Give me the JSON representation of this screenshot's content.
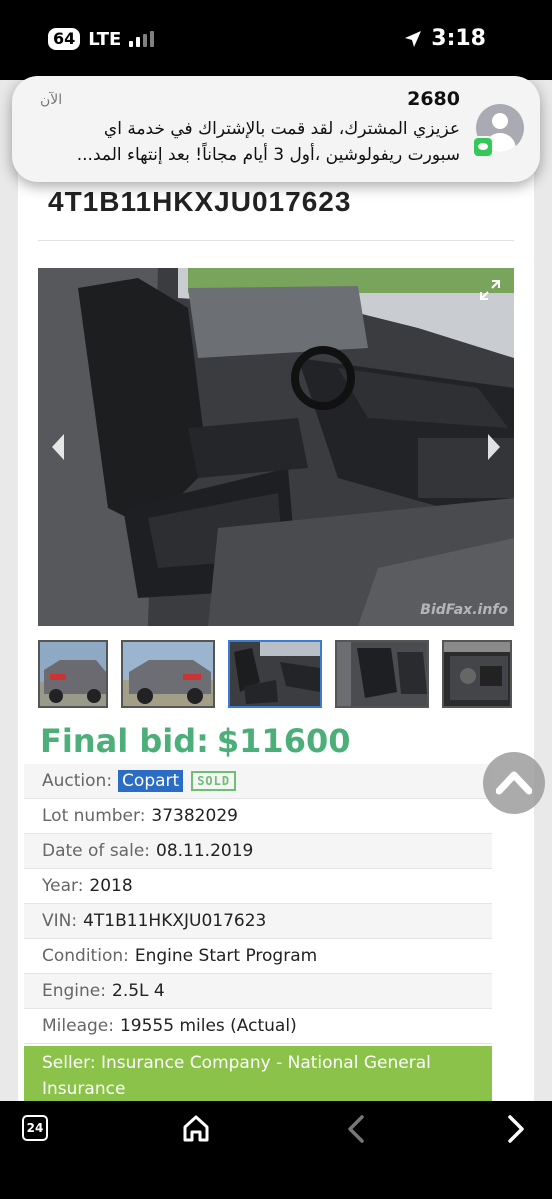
{
  "status_bar": {
    "badge": "64",
    "network": "LTE",
    "time": "3:18"
  },
  "notification": {
    "title": "2680",
    "time": "الآن",
    "line1": "عزيزي المشترك، لقد قمت بالإشتراك في خدمة اي",
    "line2": "سبورت ريفولوشين ،أول 3 أيام مجاناً! بعد إنتهاء المد..."
  },
  "listing": {
    "vin_title": "4T1B11HKXJU017623",
    "watermark": "BidFax.info",
    "final_bid_label": "Final bid:",
    "final_bid_value": "$11600",
    "details": {
      "auction_label": "Auction:",
      "auction_value": "Copart",
      "sold_badge": "SOLD",
      "lot_label": "Lot number:",
      "lot_value": "37382029",
      "date_label": "Date of sale:",
      "date_value": "08.11.2019",
      "year_label": "Year:",
      "year_value": "2018",
      "vin_label": "VIN:",
      "vin_value": "4T1B11HKXJU017623",
      "condition_label": "Condition:",
      "condition_value": "Engine Start Program",
      "engine_label": "Engine:",
      "engine_value": "2.5L 4",
      "mileage_label": "Mileage:",
      "mileage_value": "19555 miles (Actual)",
      "seller_label": "Seller:",
      "seller_value": "Insurance Company - National General Insurance"
    }
  },
  "toolbar": {
    "tabs_count": "24"
  },
  "colors": {
    "final_bid": "#4caf7a",
    "auction_link": "#2b6cc4",
    "seller_bar": "#8bc34a",
    "sold_badge": "#6cbf73"
  },
  "icons": [
    "location-arrow-icon",
    "expand-icon",
    "chevron-left-icon",
    "chevron-right-icon",
    "chevron-up-icon",
    "home-icon",
    "tabs-icon",
    "messages-app-icon"
  ]
}
